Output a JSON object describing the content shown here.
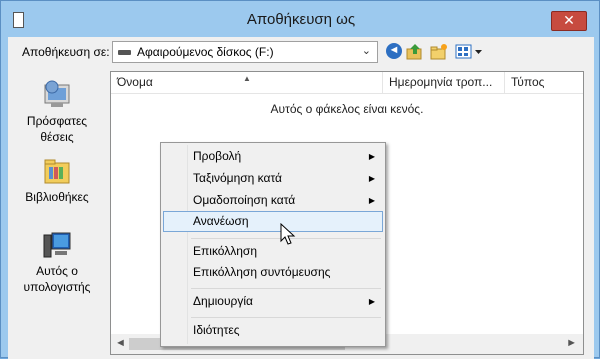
{
  "window": {
    "title": "Αποθήκευση ως",
    "close_label": "✕"
  },
  "toolbar": {
    "save_in_label": "Αποθήκευση σε:",
    "location": "Αφαιρούμενος δίσκος (F:)",
    "back_glyph": "◄"
  },
  "places": [
    {
      "label_line1": "Πρόσφατες",
      "label_line2": "θέσεις"
    },
    {
      "label_line1": "Βιβλιοθήκες",
      "label_line2": ""
    },
    {
      "label_line1": "Αυτός ο",
      "label_line2": "υπολογιστής"
    }
  ],
  "file_list": {
    "columns": [
      "Όνομα",
      "Ημερομηνία τροπ...",
      "Τύπος"
    ],
    "empty_message": "Αυτός ο φάκελος είναι κενός."
  },
  "context_menu": {
    "items": [
      {
        "label": "Προβολή",
        "submenu": true
      },
      {
        "label": "Ταξινόμηση κατά",
        "submenu": true
      },
      {
        "label": "Ομαδοποίηση κατά",
        "submenu": true
      },
      {
        "label": "Ανανέωση",
        "submenu": false,
        "highlighted": true
      },
      {
        "label": "Επικόλληση",
        "submenu": false
      },
      {
        "label": "Επικόλληση συντόμευσης",
        "submenu": false
      },
      {
        "label": "Δημιουργία",
        "submenu": true
      },
      {
        "label": "Ιδιότητες",
        "submenu": false
      }
    ]
  },
  "colors": {
    "title_bar": "#9cc9ee",
    "close_button": "#c74b3f",
    "menu_highlight": "#e5f1fb",
    "menu_highlight_border": "#7aa7d7"
  }
}
